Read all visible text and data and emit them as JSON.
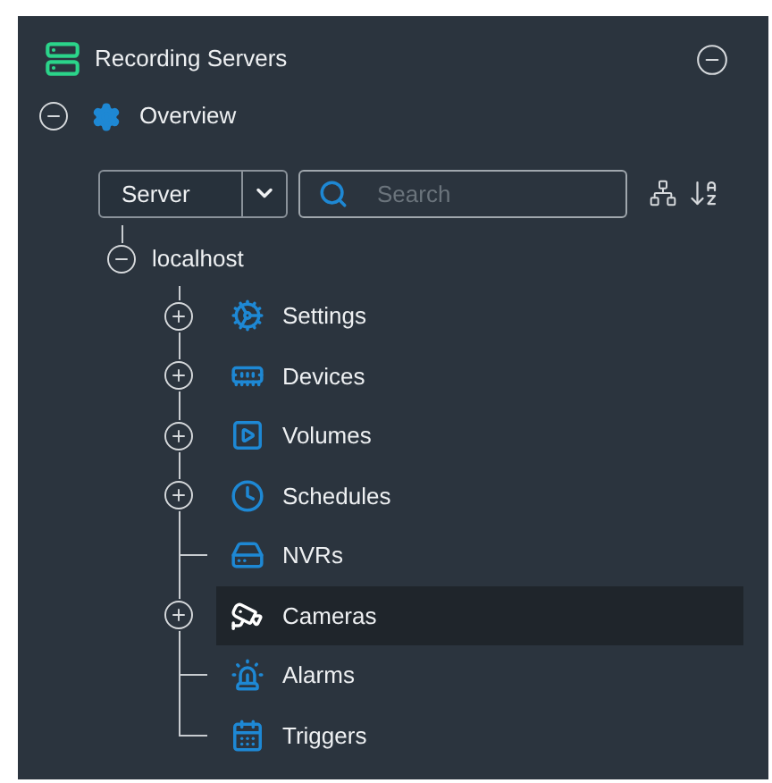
{
  "header": {
    "title": "Recording Servers",
    "expanded": true
  },
  "overview": {
    "label": "Overview",
    "expanded": true
  },
  "toolbar": {
    "filter": "Server",
    "search": {
      "placeholder": "Search"
    }
  },
  "tree": {
    "label": "localhost",
    "expanded": true,
    "children": [
      {
        "label": "Settings",
        "kind": "group",
        "expanded": false,
        "selected": false
      },
      {
        "label": "Devices",
        "kind": "group",
        "expanded": false,
        "selected": false
      },
      {
        "label": "Volumes",
        "kind": "group",
        "expanded": false,
        "selected": false
      },
      {
        "label": "Schedules",
        "kind": "group",
        "expanded": false,
        "selected": false
      },
      {
        "label": "NVRs",
        "kind": "leaf",
        "selected": false
      },
      {
        "label": "Cameras",
        "kind": "group",
        "expanded": false,
        "selected": true
      },
      {
        "label": "Alarms",
        "kind": "leaf",
        "selected": false
      },
      {
        "label": "Triggers",
        "kind": "leaf",
        "selected": false
      }
    ]
  }
}
